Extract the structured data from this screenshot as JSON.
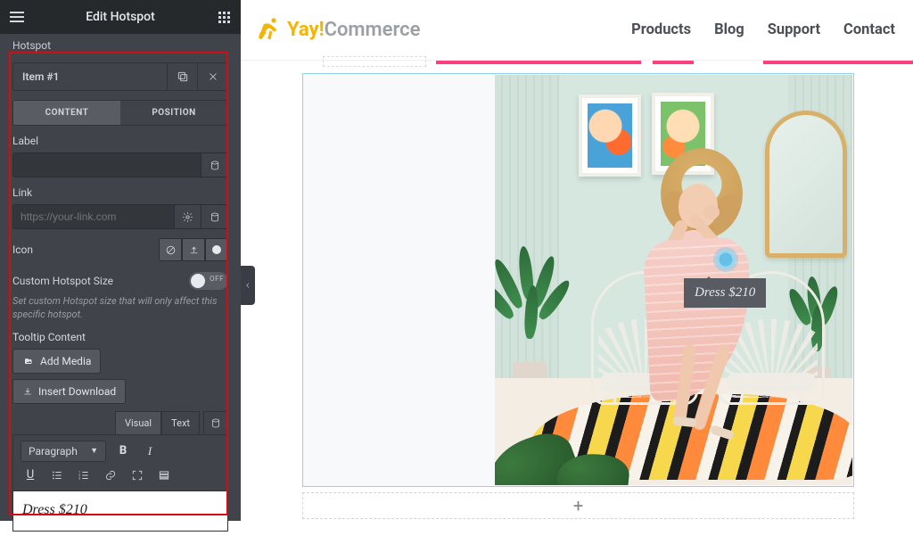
{
  "panel": {
    "title": "Edit Hotspot",
    "section": "Hotspot",
    "item_name": "Item #1",
    "tabs": {
      "content": "CONTENT",
      "position": "POSITION"
    },
    "label_field": {
      "label": "Label",
      "value": ""
    },
    "link_field": {
      "label": "Link",
      "value": "",
      "placeholder": "https://your-link.com"
    },
    "icon_label": "Icon",
    "custom_size": {
      "label": "Custom Hotspot Size",
      "state": "OFF"
    },
    "helper": "Set custom Hotspot size that will only affect this specific hotspot.",
    "tooltip_label": "Tooltip Content",
    "add_media": "Add Media",
    "insert_download": "Insert Download",
    "editor_tabs": {
      "visual": "Visual",
      "text": "Text"
    },
    "format_select": "Paragraph",
    "editor_content": "Dress $210"
  },
  "topnav": {
    "brand_a": "Yay!",
    "brand_b": "Commerce",
    "links": [
      "Products",
      "Blog",
      "Support",
      "Contact"
    ]
  },
  "canvas": {
    "tooltip": "Dress $210",
    "add_section_label": "+"
  }
}
